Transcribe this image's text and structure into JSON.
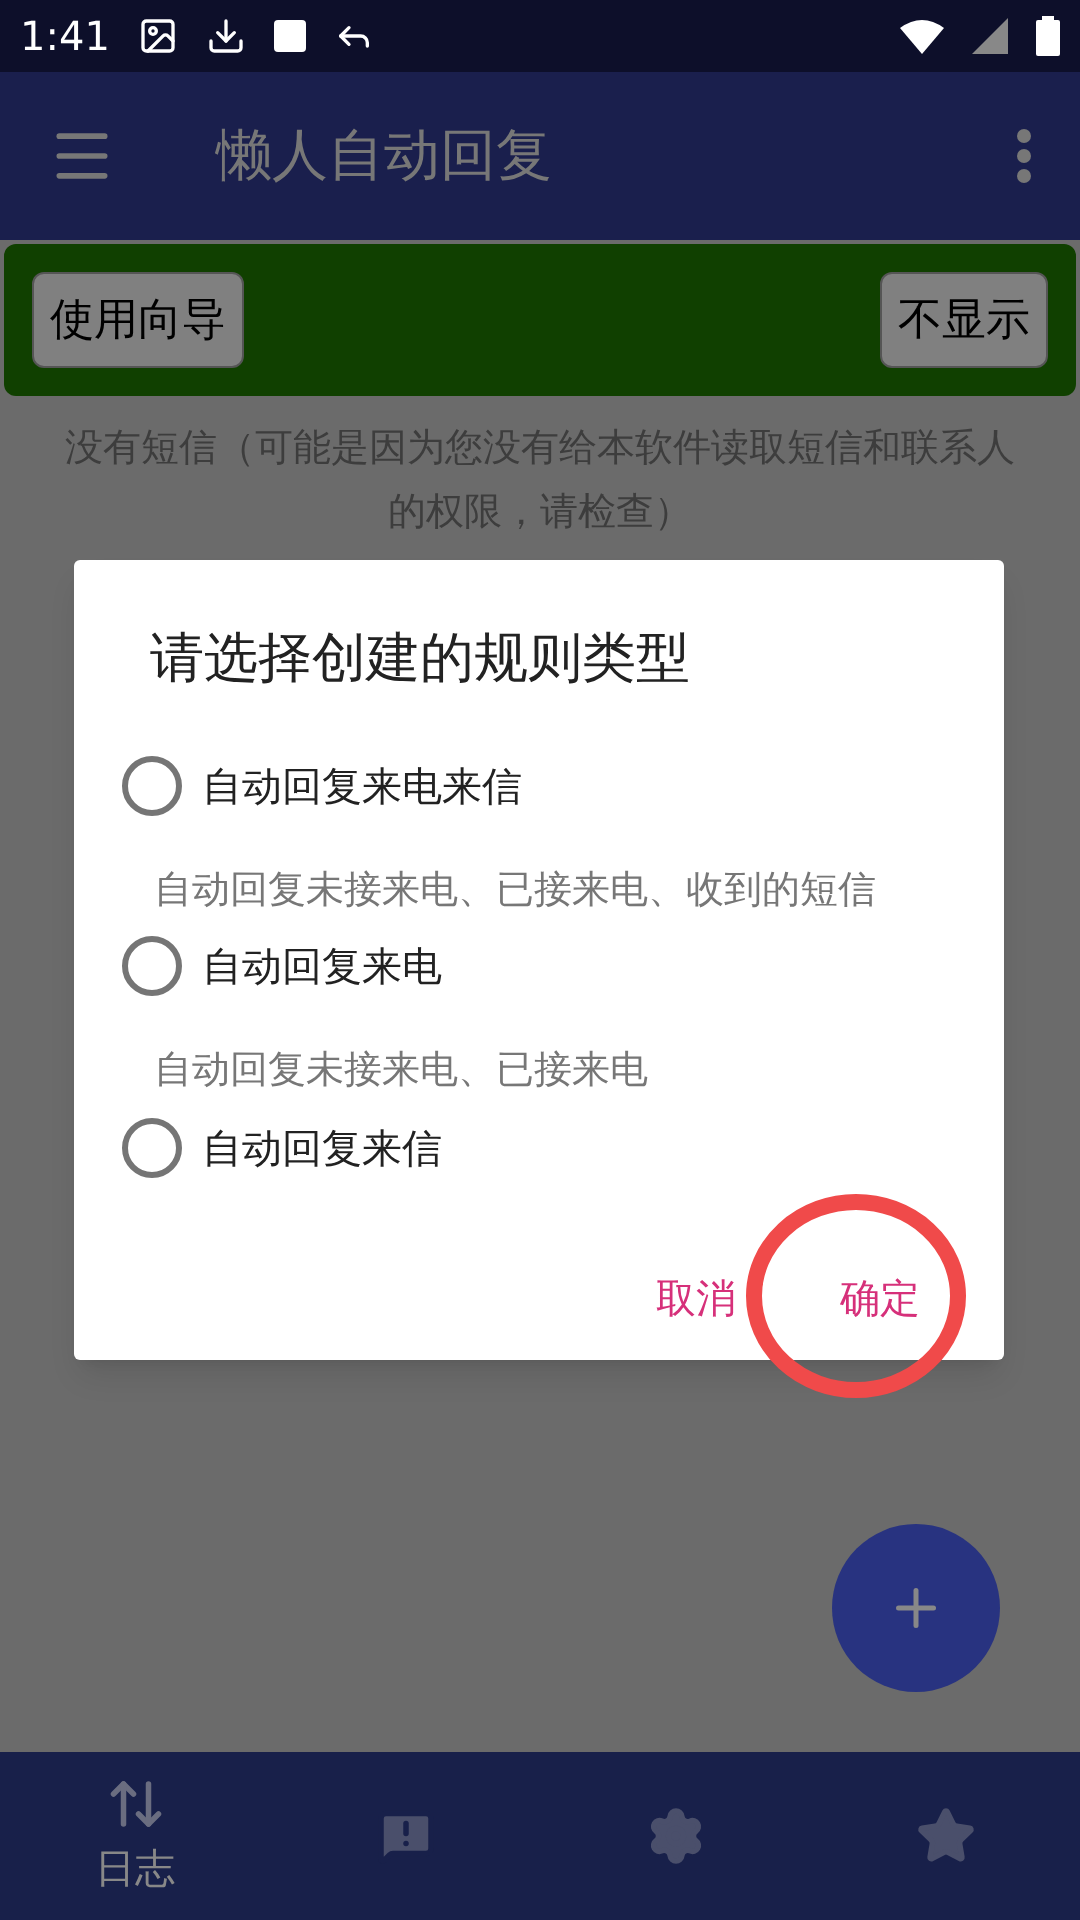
{
  "status_bar": {
    "time": "1:41"
  },
  "app_bar": {
    "title": "懒人自动回复"
  },
  "banner": {
    "buttons": [
      "使用向导",
      "不显示"
    ]
  },
  "message": "没有短信（可能是因为您没有给本软件读取短信和联系人的权限，请检查）",
  "dialog": {
    "title": "请选择创建的规则类型",
    "options": [
      {
        "label": "自动回复来电来信",
        "description": "自动回复未接来电、已接来电、收到的短信",
        "selected": false
      },
      {
        "label": "自动回复来电",
        "description": "自动回复未接来电、已接来电",
        "selected": false
      },
      {
        "label": "自动回复来信",
        "selected": false
      }
    ],
    "buttons": [
      {
        "label": "取消",
        "highlighted": false
      },
      {
        "label": "确定",
        "highlighted": true
      }
    ]
  },
  "bottom_nav": [
    {
      "kind": "log",
      "label": "日志",
      "selected": true
    },
    {
      "kind": "feedback",
      "selected": false
    },
    {
      "kind": "settings",
      "selected": false
    },
    {
      "kind": "star",
      "selected": false
    }
  ]
}
